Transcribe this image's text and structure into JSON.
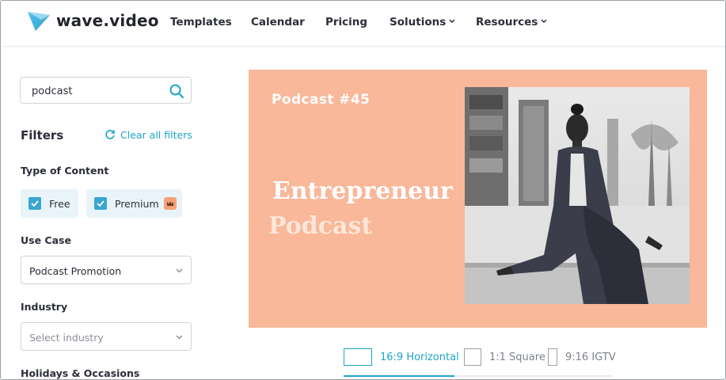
{
  "brand": {
    "name": "wave.video"
  },
  "nav": {
    "items": [
      {
        "label": "Templates",
        "dropdown": false
      },
      {
        "label": "Calendar",
        "dropdown": false
      },
      {
        "label": "Pricing",
        "dropdown": false
      },
      {
        "label": "Solutions",
        "dropdown": true
      },
      {
        "label": "Resources",
        "dropdown": true
      }
    ]
  },
  "sidebar": {
    "search": {
      "value": "podcast"
    },
    "filters_title": "Filters",
    "clear_filters": "Clear all filters",
    "type_of_content": {
      "label": "Type of Content",
      "options": [
        {
          "label": "Free",
          "checked": true
        },
        {
          "label": "Premium",
          "checked": true,
          "badge_icon": "crown-icon"
        }
      ]
    },
    "use_case": {
      "label": "Use Case",
      "selected": "Podcast Promotion"
    },
    "industry": {
      "label": "Industry",
      "placeholder": "Select industry"
    },
    "holidays": {
      "label": "Holidays & Occasions"
    }
  },
  "preview": {
    "tag": "Podcast #45",
    "title": "Entrepreneur",
    "subtitle": "Podcast",
    "background_color": "#f8b899"
  },
  "aspect_ratios": [
    {
      "label": "16:9 Horizontal",
      "active": true
    },
    {
      "label": "1:1 Square",
      "active": false
    },
    {
      "label": "9:16 IGTV",
      "active": false
    }
  ],
  "colors": {
    "accent": "#1fa4c8",
    "checkbox": "#3aa6d0",
    "premium_badge": "#f6a177",
    "text": "#2b2e38"
  }
}
